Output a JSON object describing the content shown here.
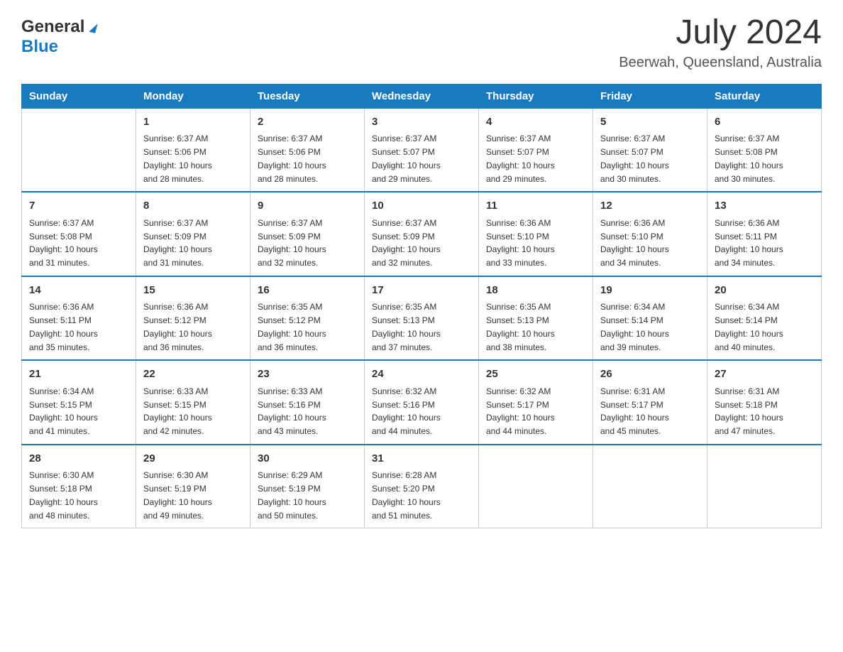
{
  "header": {
    "logo_text_general": "General",
    "logo_text_blue": "Blue",
    "month_year": "July 2024",
    "location": "Beerwah, Queensland, Australia"
  },
  "days_of_week": [
    "Sunday",
    "Monday",
    "Tuesday",
    "Wednesday",
    "Thursday",
    "Friday",
    "Saturday"
  ],
  "weeks": [
    [
      {
        "day": "",
        "info": ""
      },
      {
        "day": "1",
        "info": "Sunrise: 6:37 AM\nSunset: 5:06 PM\nDaylight: 10 hours\nand 28 minutes."
      },
      {
        "day": "2",
        "info": "Sunrise: 6:37 AM\nSunset: 5:06 PM\nDaylight: 10 hours\nand 28 minutes."
      },
      {
        "day": "3",
        "info": "Sunrise: 6:37 AM\nSunset: 5:07 PM\nDaylight: 10 hours\nand 29 minutes."
      },
      {
        "day": "4",
        "info": "Sunrise: 6:37 AM\nSunset: 5:07 PM\nDaylight: 10 hours\nand 29 minutes."
      },
      {
        "day": "5",
        "info": "Sunrise: 6:37 AM\nSunset: 5:07 PM\nDaylight: 10 hours\nand 30 minutes."
      },
      {
        "day": "6",
        "info": "Sunrise: 6:37 AM\nSunset: 5:08 PM\nDaylight: 10 hours\nand 30 minutes."
      }
    ],
    [
      {
        "day": "7",
        "info": "Sunrise: 6:37 AM\nSunset: 5:08 PM\nDaylight: 10 hours\nand 31 minutes."
      },
      {
        "day": "8",
        "info": "Sunrise: 6:37 AM\nSunset: 5:09 PM\nDaylight: 10 hours\nand 31 minutes."
      },
      {
        "day": "9",
        "info": "Sunrise: 6:37 AM\nSunset: 5:09 PM\nDaylight: 10 hours\nand 32 minutes."
      },
      {
        "day": "10",
        "info": "Sunrise: 6:37 AM\nSunset: 5:09 PM\nDaylight: 10 hours\nand 32 minutes."
      },
      {
        "day": "11",
        "info": "Sunrise: 6:36 AM\nSunset: 5:10 PM\nDaylight: 10 hours\nand 33 minutes."
      },
      {
        "day": "12",
        "info": "Sunrise: 6:36 AM\nSunset: 5:10 PM\nDaylight: 10 hours\nand 34 minutes."
      },
      {
        "day": "13",
        "info": "Sunrise: 6:36 AM\nSunset: 5:11 PM\nDaylight: 10 hours\nand 34 minutes."
      }
    ],
    [
      {
        "day": "14",
        "info": "Sunrise: 6:36 AM\nSunset: 5:11 PM\nDaylight: 10 hours\nand 35 minutes."
      },
      {
        "day": "15",
        "info": "Sunrise: 6:36 AM\nSunset: 5:12 PM\nDaylight: 10 hours\nand 36 minutes."
      },
      {
        "day": "16",
        "info": "Sunrise: 6:35 AM\nSunset: 5:12 PM\nDaylight: 10 hours\nand 36 minutes."
      },
      {
        "day": "17",
        "info": "Sunrise: 6:35 AM\nSunset: 5:13 PM\nDaylight: 10 hours\nand 37 minutes."
      },
      {
        "day": "18",
        "info": "Sunrise: 6:35 AM\nSunset: 5:13 PM\nDaylight: 10 hours\nand 38 minutes."
      },
      {
        "day": "19",
        "info": "Sunrise: 6:34 AM\nSunset: 5:14 PM\nDaylight: 10 hours\nand 39 minutes."
      },
      {
        "day": "20",
        "info": "Sunrise: 6:34 AM\nSunset: 5:14 PM\nDaylight: 10 hours\nand 40 minutes."
      }
    ],
    [
      {
        "day": "21",
        "info": "Sunrise: 6:34 AM\nSunset: 5:15 PM\nDaylight: 10 hours\nand 41 minutes."
      },
      {
        "day": "22",
        "info": "Sunrise: 6:33 AM\nSunset: 5:15 PM\nDaylight: 10 hours\nand 42 minutes."
      },
      {
        "day": "23",
        "info": "Sunrise: 6:33 AM\nSunset: 5:16 PM\nDaylight: 10 hours\nand 43 minutes."
      },
      {
        "day": "24",
        "info": "Sunrise: 6:32 AM\nSunset: 5:16 PM\nDaylight: 10 hours\nand 44 minutes."
      },
      {
        "day": "25",
        "info": "Sunrise: 6:32 AM\nSunset: 5:17 PM\nDaylight: 10 hours\nand 44 minutes."
      },
      {
        "day": "26",
        "info": "Sunrise: 6:31 AM\nSunset: 5:17 PM\nDaylight: 10 hours\nand 45 minutes."
      },
      {
        "day": "27",
        "info": "Sunrise: 6:31 AM\nSunset: 5:18 PM\nDaylight: 10 hours\nand 47 minutes."
      }
    ],
    [
      {
        "day": "28",
        "info": "Sunrise: 6:30 AM\nSunset: 5:18 PM\nDaylight: 10 hours\nand 48 minutes."
      },
      {
        "day": "29",
        "info": "Sunrise: 6:30 AM\nSunset: 5:19 PM\nDaylight: 10 hours\nand 49 minutes."
      },
      {
        "day": "30",
        "info": "Sunrise: 6:29 AM\nSunset: 5:19 PM\nDaylight: 10 hours\nand 50 minutes."
      },
      {
        "day": "31",
        "info": "Sunrise: 6:28 AM\nSunset: 5:20 PM\nDaylight: 10 hours\nand 51 minutes."
      },
      {
        "day": "",
        "info": ""
      },
      {
        "day": "",
        "info": ""
      },
      {
        "day": "",
        "info": ""
      }
    ]
  ]
}
